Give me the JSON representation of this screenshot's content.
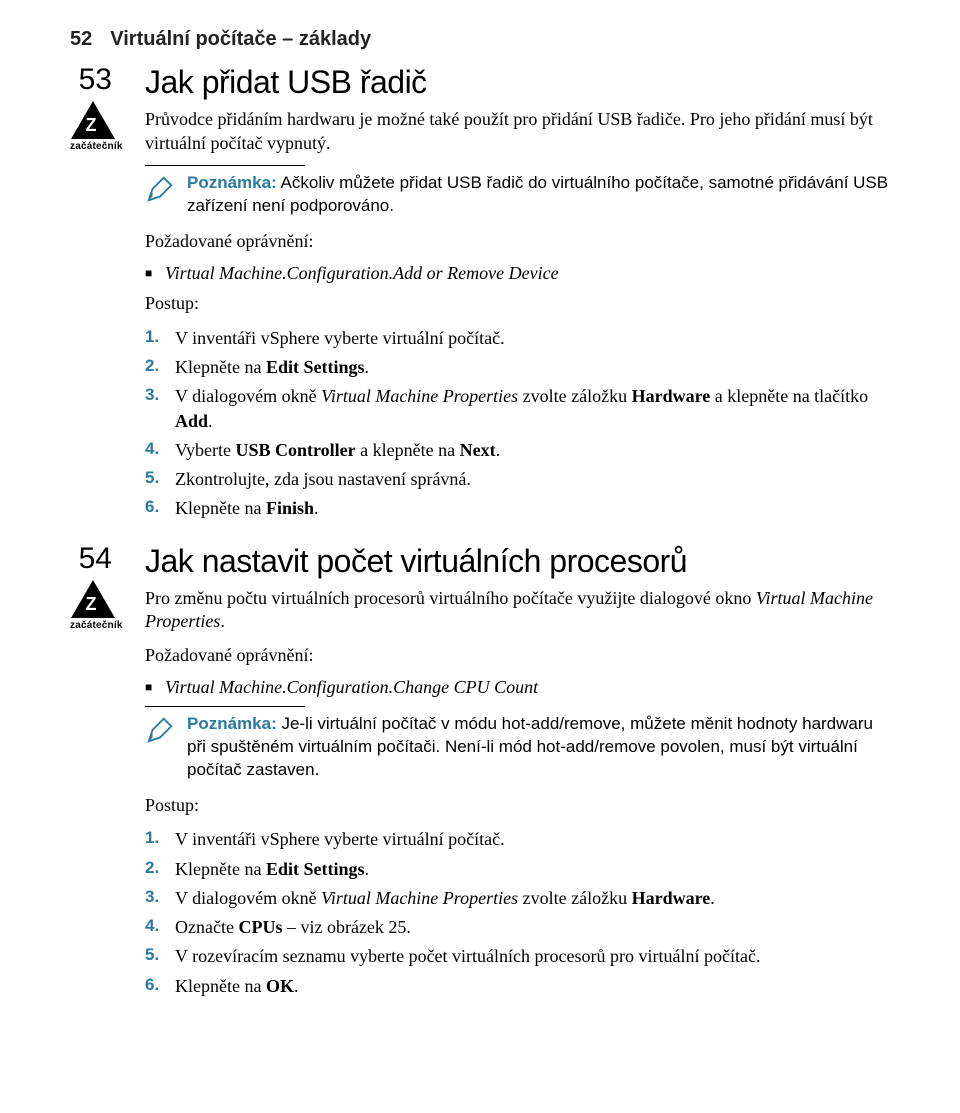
{
  "header": {
    "page_number": "52",
    "chapter": "Virtuální počítače – základy"
  },
  "badge_label": "začátečník",
  "sec53": {
    "num": "53",
    "title": "Jak přidat USB řadič",
    "intro": "Průvodce přidáním hardwaru je možné také použít pro přidání USB řadiče. Pro jeho přidání musí být virtuální počítač vypnutý.",
    "note_label": "Poznámka:",
    "note": " Ačkoliv můžete přidat USB řadič do virtuálního počítače, samotné přidávání USB zařízení není podporováno.",
    "perm_label": "Požadované oprávnění:",
    "perm": "Virtual Machine.Configuration.Add or Remove Device",
    "steps_label": "Postup:",
    "steps": {
      "s1": "V inventáři vSphere vyberte virtuální počítač.",
      "s2a": "Klepněte na ",
      "s2b": "Edit Settings",
      "s2c": ".",
      "s3a": "V dialogovém okně ",
      "s3b": "Virtual Machine Properties",
      "s3c": " zvolte záložku ",
      "s3d": "Hardware",
      "s3e": " a klepněte na tlačítko ",
      "s3f": "Add",
      "s3g": ".",
      "s4a": "Vyberte ",
      "s4b": "USB Controller",
      "s4c": " a klepněte na ",
      "s4d": "Next",
      "s4e": ".",
      "s5": "Zkontrolujte, zda jsou nastavení správná.",
      "s6a": "Klepněte na ",
      "s6b": "Finish",
      "s6c": "."
    }
  },
  "sec54": {
    "num": "54",
    "title": "Jak nastavit počet virtuálních procesorů",
    "intro_a": "Pro změnu počtu virtuálních procesorů virtuálního počítače využijte dialogové okno ",
    "intro_b": "Virtual Machine Properties",
    "intro_c": ".",
    "perm_label": "Požadované oprávnění:",
    "perm": "Virtual Machine.Configuration.Change CPU Count",
    "note_label": "Poznámka:",
    "note": " Je-li virtuální počítač v módu hot-add/remove, můžete měnit hodnoty hardwaru při spuštěném virtuálním počítači. Není-li mód hot-add/remove povolen, musí být virtuální počítač zastaven.",
    "steps_label": "Postup:",
    "steps": {
      "s1": "V inventáři vSphere vyberte virtuální počítač.",
      "s2a": "Klepněte na ",
      "s2b": "Edit Settings",
      "s2c": ".",
      "s3a": "V dialogovém okně ",
      "s3b": "Virtual Machine Properties",
      "s3c": " zvolte záložku ",
      "s3d": "Hardware",
      "s3e": ".",
      "s4a": "Označte ",
      "s4b": "CPUs",
      "s4c": " – viz obrázek 25.",
      "s5": "V rozevíracím seznamu vyberte počet virtuálních procesorů pro virtuální počítač.",
      "s6a": "Klepněte na ",
      "s6b": "OK",
      "s6c": "."
    }
  }
}
